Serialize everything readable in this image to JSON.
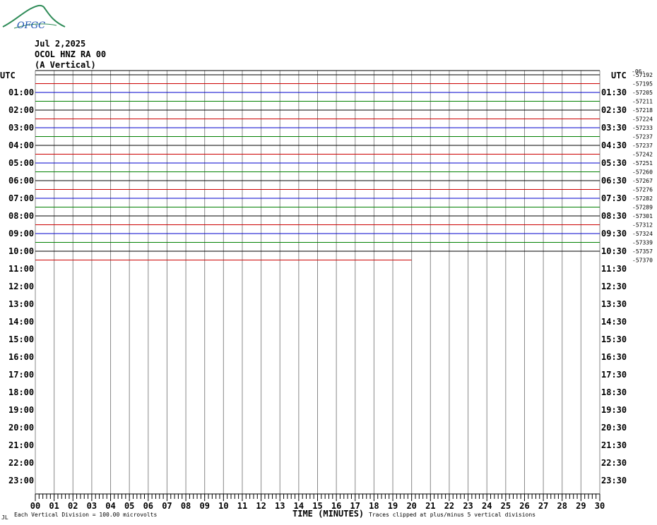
{
  "logo": {
    "text": "OFGC",
    "icon": "mountain-swoosh-logo-icon",
    "colors": {
      "swoosh": "#2e8b57",
      "text": "#1a4fb0"
    }
  },
  "header": {
    "date": "Jul 2,2025",
    "station": "OCOL HNZ RA 00",
    "component": "(A Vertical)"
  },
  "chart_data": {
    "type": "helicorder",
    "left_axis_title": "UTC",
    "right_axis_title": "UTC",
    "left_hour_labels": [
      "01:00",
      "02:00",
      "03:00",
      "04:00",
      "05:00",
      "06:00",
      "07:00",
      "08:00",
      "09:00",
      "10:00",
      "11:00",
      "12:00",
      "13:00",
      "14:00",
      "15:00",
      "16:00",
      "17:00",
      "18:00",
      "19:00",
      "20:00",
      "21:00",
      "22:00",
      "23:00"
    ],
    "right_hour_labels": [
      "01:30",
      "02:30",
      "03:30",
      "04:30",
      "05:30",
      "06:30",
      "07:30",
      "08:30",
      "09:30",
      "10:30",
      "11:30",
      "12:30",
      "13:30",
      "14:30",
      "15:30",
      "16:30",
      "17:30",
      "18:30",
      "19:30",
      "20:30",
      "21:30",
      "22:30",
      "23:30"
    ],
    "right_extra_label": "-06-",
    "x_ticks": [
      "00",
      "01",
      "02",
      "03",
      "04",
      "05",
      "06",
      "07",
      "08",
      "09",
      "10",
      "11",
      "12",
      "13",
      "14",
      "15",
      "16",
      "17",
      "18",
      "19",
      "20",
      "21",
      "22",
      "23",
      "24",
      "25",
      "26",
      "27",
      "28",
      "29",
      "30"
    ],
    "xlim": [
      0,
      30
    ],
    "xlabel": "TIME (MINUTES)",
    "trace_colors": [
      "#000000",
      "#cc0000",
      "#0000cc",
      "#008000"
    ],
    "trace_count_values": [
      "-57192",
      "-57195",
      "-57205",
      "-57211",
      "-57218",
      "-57224",
      "-57233",
      "-57237",
      "-57237",
      "-57242",
      "-57251",
      "-57260",
      "-57267",
      "-57276",
      "-57282",
      "-57289",
      "-57301",
      "-57312",
      "-57324",
      "-57339",
      "-57357",
      "-57370"
    ],
    "partial_last_trace_minutes": 20,
    "footer_left": "Each Vertical Division =  100.00 microvolts",
    "footer_right": "Traces clipped at plus/minus 5 vertical divisions",
    "footer_mark": "JL"
  }
}
